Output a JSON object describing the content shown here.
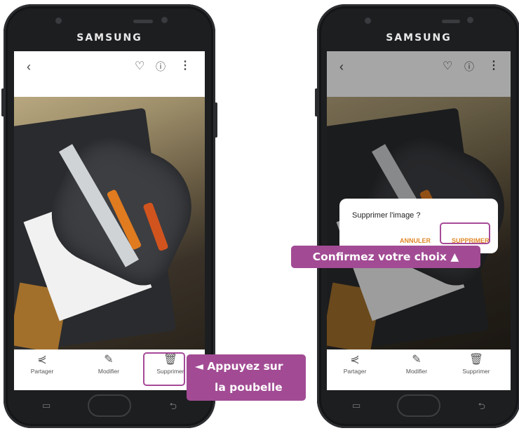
{
  "brand": "SAMSUNG",
  "left_screen": {
    "toolbar": {
      "back_icon": "back-arrow-icon",
      "favorite_icon": "heart-icon",
      "info_icon": "info-icon",
      "more_icon": "more-vertical-icon"
    },
    "actions": [
      {
        "label": "Partager",
        "icon": "share-icon"
      },
      {
        "label": "Modifier",
        "icon": "pencil-icon"
      },
      {
        "label": "Supprimer",
        "icon": "trash-icon"
      }
    ]
  },
  "right_screen": {
    "dialog": {
      "question": "Supprimer l'image ?",
      "cancel_label": "ANNULER",
      "confirm_label": "SUPPRIMER"
    },
    "actions": [
      {
        "label": "Partager",
        "icon": "share-icon"
      },
      {
        "label": "Modifier",
        "icon": "pencil-icon"
      },
      {
        "label": "Supprimer",
        "icon": "trash-icon"
      }
    ]
  },
  "callouts": {
    "trash_line1": "◄ Appuyez sur",
    "trash_line2": "la poubelle",
    "confirm": "Confirmez votre choix ▲"
  },
  "colors": {
    "callout": "#a24b94",
    "dialog_button": "#e0882a"
  }
}
